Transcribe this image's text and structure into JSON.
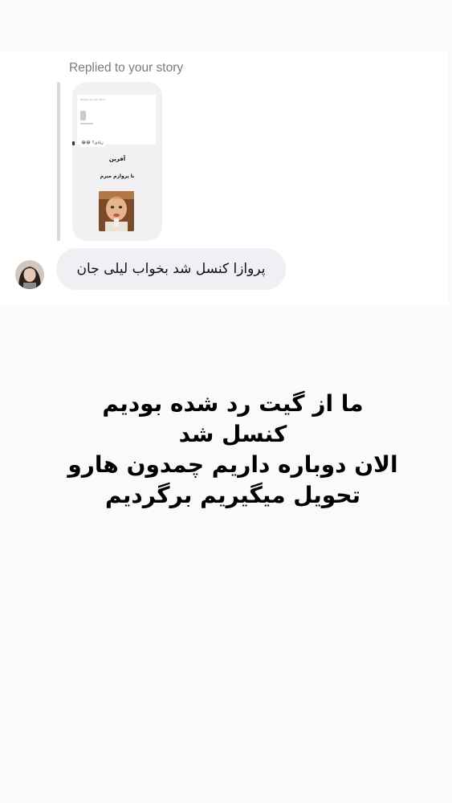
{
  "story_reply": {
    "label": "Replied to your story",
    "thumbnail": {
      "mini_replied_label": "Replied to your story",
      "reaction_text": "زیادی؟ 😂😂",
      "line1": "آفرین",
      "line2": "با پروازم میرم"
    }
  },
  "message": {
    "text": "پروازا کنسل شد بخواب لیلی جان"
  },
  "overlay": {
    "lines": [
      "ما از گیت رد شده بودیم",
      "کنسل شد",
      "الان دوباره داریم چمدون هارو",
      "تحویل میگیریم برگردیم"
    ]
  }
}
